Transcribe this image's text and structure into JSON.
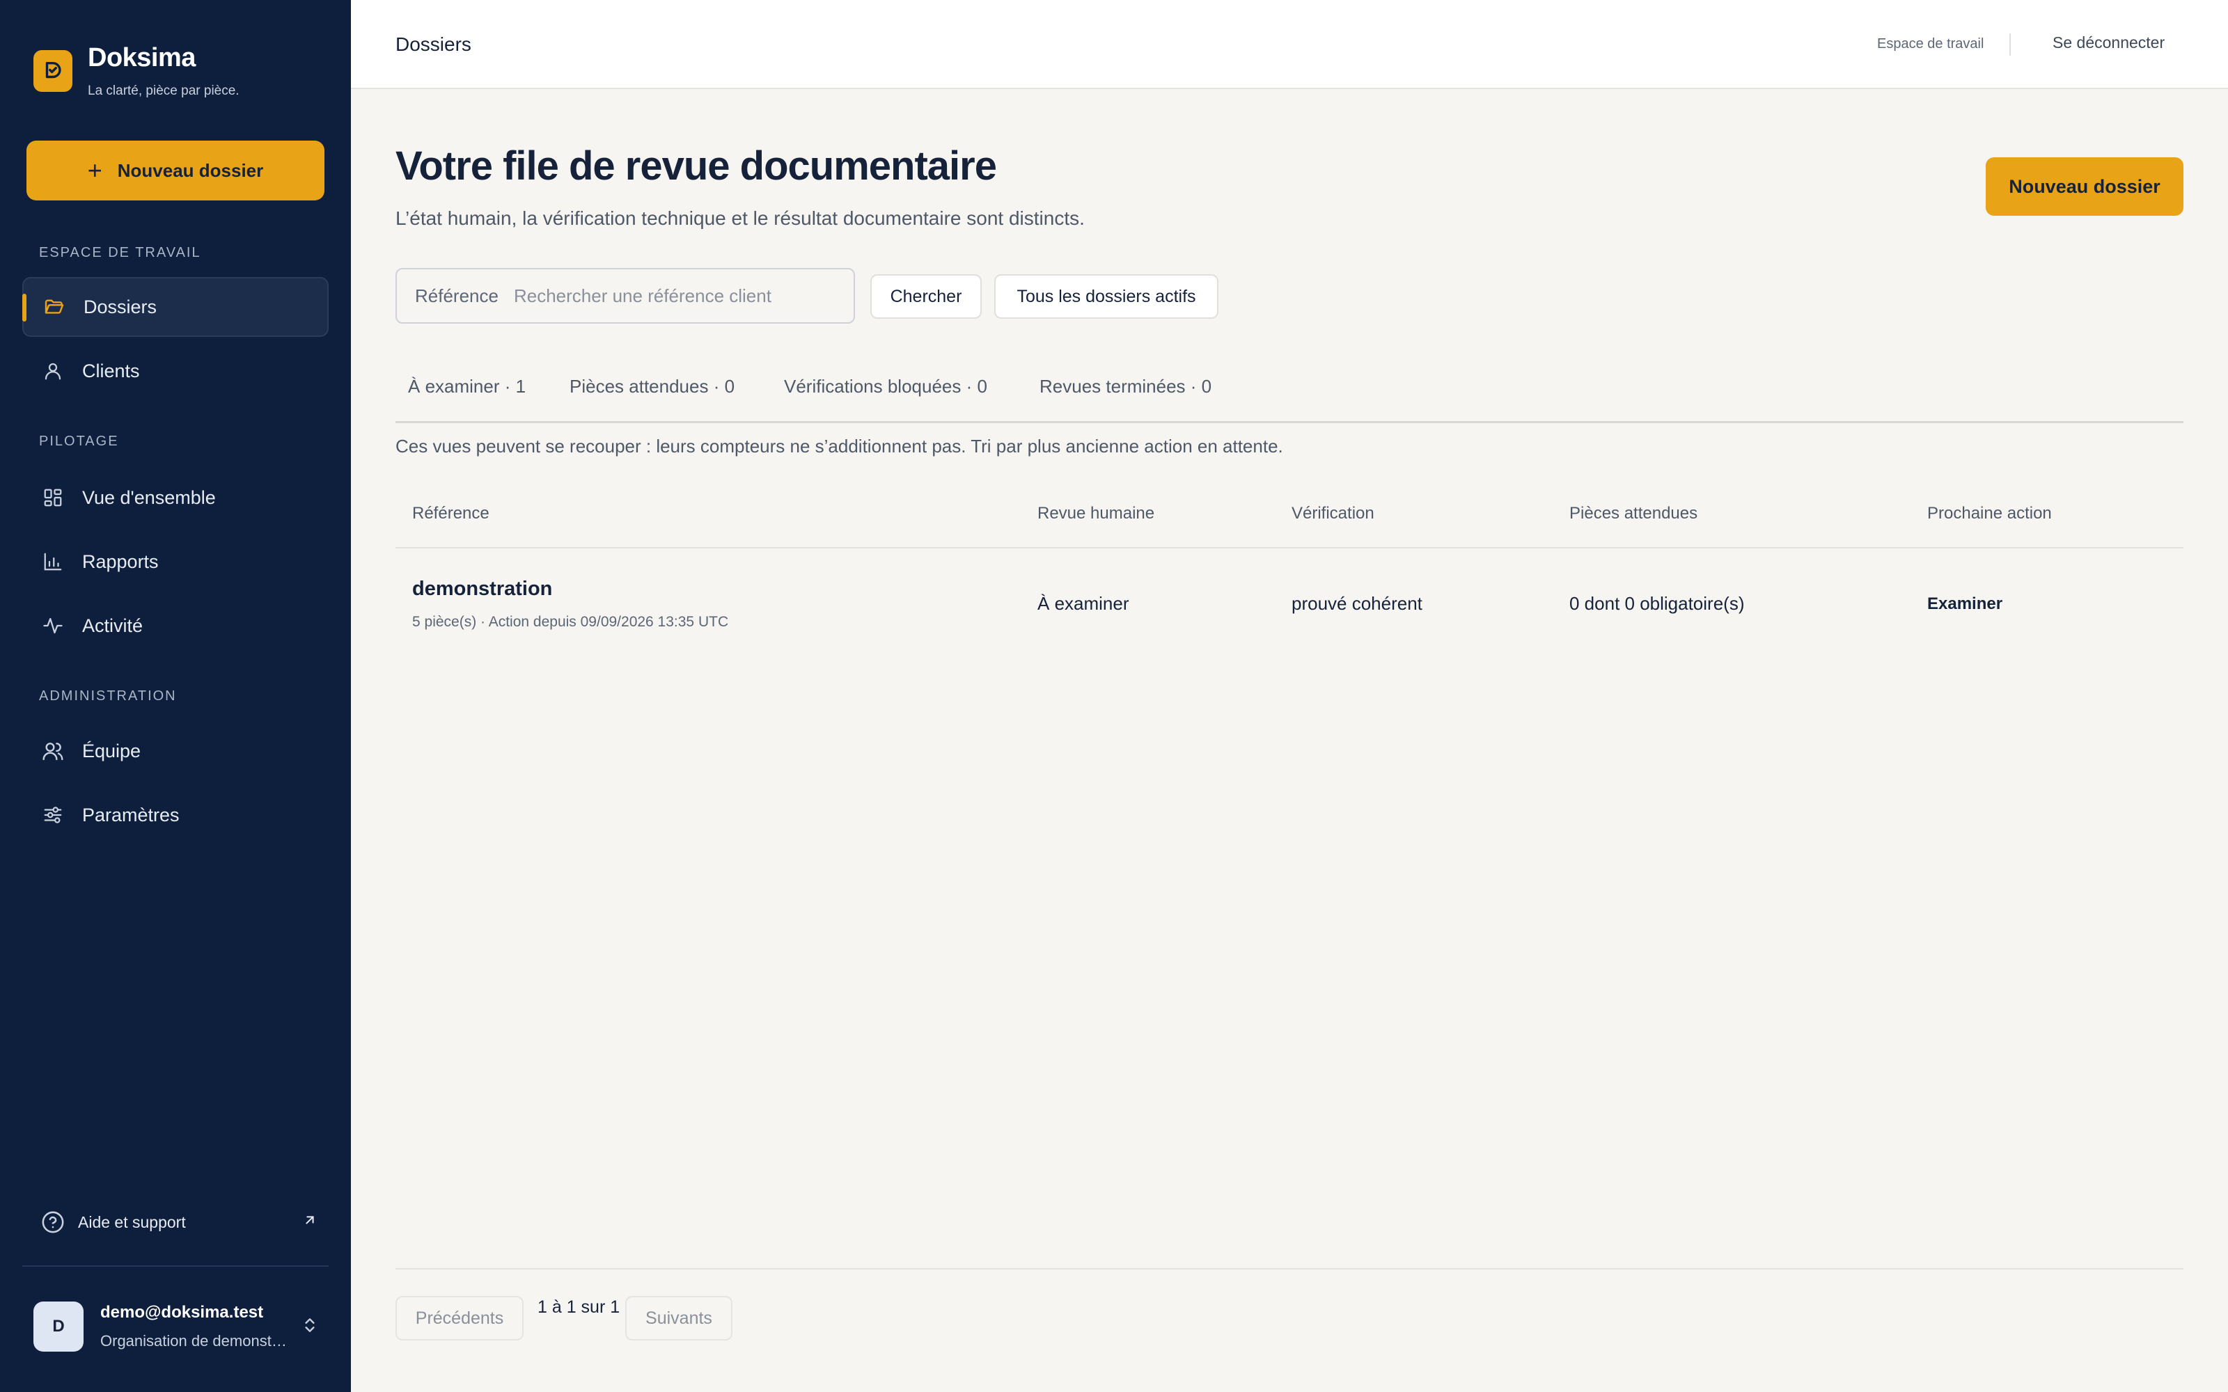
{
  "brand": {
    "name": "Doksima",
    "tagline": "La clarté, pièce par pièce."
  },
  "sidebar": {
    "new_button": "Nouveau dossier",
    "sections": [
      {
        "label": "ESPACE DE TRAVAIL",
        "items": [
          {
            "label": "Dossiers",
            "icon": "folder-open-icon",
            "active": true
          },
          {
            "label": "Clients",
            "icon": "user-icon"
          }
        ]
      },
      {
        "label": "PILOTAGE",
        "items": [
          {
            "label": "Vue d'ensemble",
            "icon": "dashboard-grid-icon"
          },
          {
            "label": "Rapports",
            "icon": "bar-chart-icon"
          },
          {
            "label": "Activité",
            "icon": "activity-icon"
          }
        ]
      },
      {
        "label": "ADMINISTRATION",
        "items": [
          {
            "label": "Équipe",
            "icon": "users-icon"
          },
          {
            "label": "Paramètres",
            "icon": "sliders-icon"
          }
        ]
      }
    ],
    "help": "Aide et support",
    "user": {
      "initial": "D",
      "email": "demo@doksima.test",
      "org": "Organisation de demonstration"
    }
  },
  "topbar": {
    "title": "Dossiers",
    "workspace": "Espace de travail",
    "logout": "Se déconnecter"
  },
  "main": {
    "title": "Votre file de revue documentaire",
    "subtitle": "L’état humain, la vérification technique et le résultat documentaire sont distincts.",
    "new_button": "Nouveau dossier",
    "search": {
      "label": "Référence",
      "placeholder": "Rechercher une référence client",
      "value": ""
    },
    "search_button": "Chercher",
    "all_button": "Tous les dossiers actifs",
    "tabs": [
      "À examiner · 1",
      "Pièces attendues · 0",
      "Vérifications bloquées · 0",
      "Revues terminées · 0"
    ],
    "note": "Ces vues peuvent se recouper : leurs compteurs ne s’additionnent pas. Tri par plus ancienne action en attente.",
    "table": {
      "columns": [
        "Référence",
        "Revue humaine",
        "Vérification",
        "Pièces attendues",
        "Prochaine action"
      ],
      "rows": [
        {
          "reference": "demonstration",
          "meta": "5 pièce(s) · Action depuis 09/09/2026 13:35 UTC",
          "human_review": "À examiner",
          "verification": "prouvé cohérent",
          "expected": "0 dont 0 obligatoire(s)",
          "action": "Examiner"
        }
      ]
    },
    "pagination": {
      "prev": "Précédents",
      "info": "1 à 1 sur 1",
      "next": "Suivants"
    }
  },
  "colors": {
    "sidebar_bg": "#0d1f3c",
    "accent": "#e8a317",
    "page_bg": "#f6f5f2",
    "text": "#16223a"
  }
}
